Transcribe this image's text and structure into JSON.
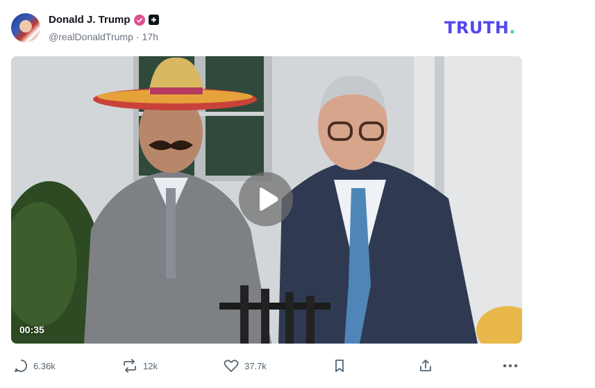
{
  "post": {
    "display_name": "Donald J. Trump",
    "handle": "@realDonaldTrump",
    "separator": "·",
    "time": "17h"
  },
  "brand": {
    "logo_text": "TRUTH",
    "logo_dot": ".",
    "logo_color": "#5448ee",
    "logo_dot_color": "#2dd4a6"
  },
  "video": {
    "duration": "00:35"
  },
  "actions": {
    "replies": "6.36k",
    "retruths": "12k",
    "likes": "37.7k"
  },
  "icons": [
    "verified-icon",
    "plus-icon",
    "play-icon",
    "reply-icon",
    "retruth-icon",
    "like-icon",
    "bookmark-icon",
    "share-icon",
    "more-icon"
  ]
}
